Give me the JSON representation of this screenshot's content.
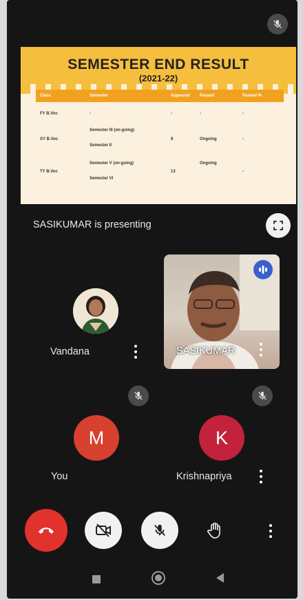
{
  "slide": {
    "title": "SEMESTER END RESULT",
    "subtitle": "(2021-22)",
    "columns": [
      "Class",
      "Semester",
      "Appeared",
      "Passed",
      "Passed %"
    ],
    "rows": [
      {
        "class": "FY B.Voc",
        "semester": [
          "-"
        ],
        "appeared": "-",
        "passed": "-",
        "percent": "-"
      },
      {
        "class": "SY B.Voc",
        "semester": [
          "Semester III (on-going)",
          "Semester II"
        ],
        "appeared": "8",
        "passed": "Ongoing",
        "percent": "-"
      },
      {
        "class": "TY B.Voc",
        "semester": [
          "Semester V (on-going)",
          "Semester VI"
        ],
        "appeared": "13",
        "passed": "Ongoing",
        "percent": "-"
      }
    ]
  },
  "presenting_text": "SASIKUMAR is presenting",
  "participants": {
    "vandana": {
      "name": "Vandana"
    },
    "sasikumar": {
      "name": "SASIKUMAR"
    },
    "you": {
      "name": "You",
      "initial": "M",
      "color": "#d7402f"
    },
    "krishnapriya": {
      "name": "Krishnapriya",
      "initial": "K",
      "color": "#c2223c"
    }
  },
  "colors": {
    "end_call": "#e1322e",
    "control_light": "#f1f1f1",
    "background": "#151515"
  },
  "icons": {
    "top_mute": "mic-off-icon",
    "fullscreen": "fullscreen-icon",
    "speaking": "audio-wave-icon",
    "end_call": "phone-hangup-icon",
    "camera": "camera-off-icon",
    "mic": "mic-off-icon",
    "hand": "raise-hand-icon",
    "more": "more-vert-icon"
  }
}
